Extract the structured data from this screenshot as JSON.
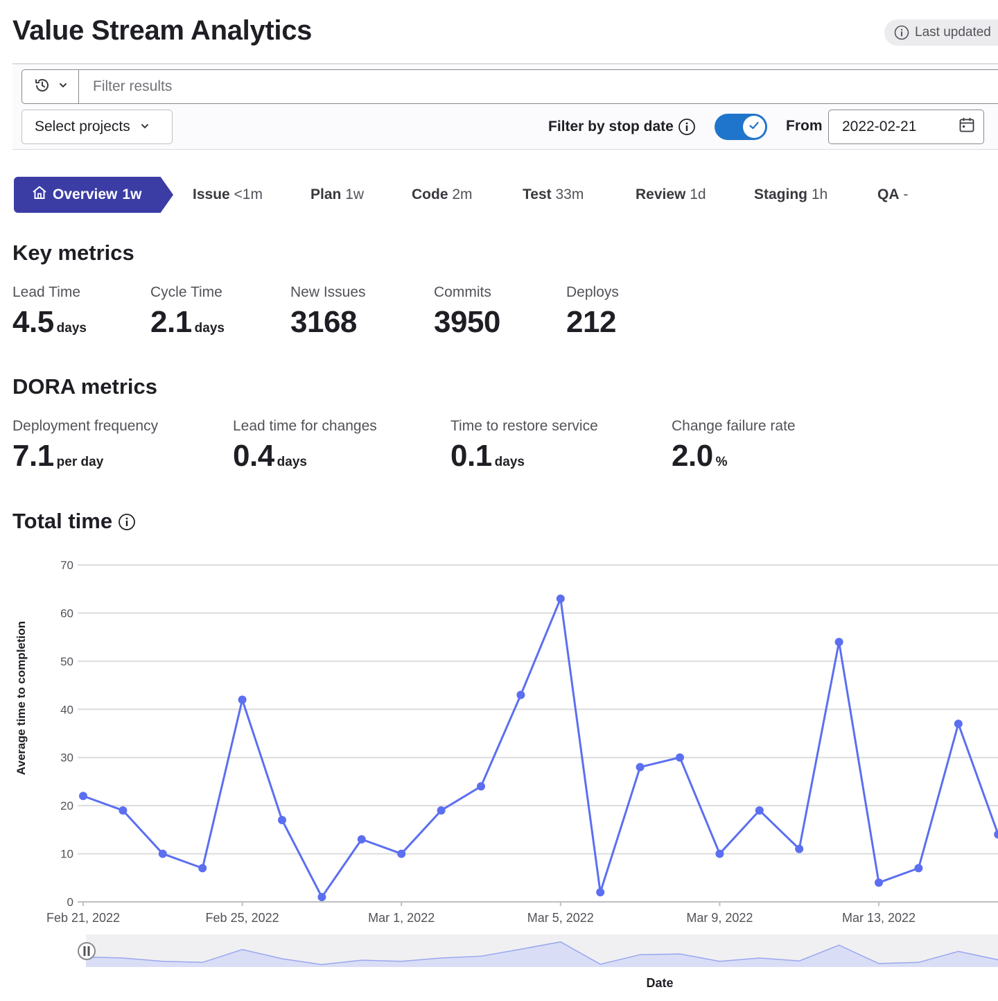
{
  "page": {
    "title": "Value Stream Analytics",
    "last_updated": "Last updated"
  },
  "filters": {
    "search_placeholder": "Filter results",
    "projects_label": "Select projects",
    "stop_date_label": "Filter by stop date",
    "stop_date_enabled": true,
    "from_label": "From",
    "from_date": "2022-02-21"
  },
  "stages": [
    {
      "name": "Overview",
      "time": "1w",
      "active": true
    },
    {
      "name": "Issue",
      "time": "<1m"
    },
    {
      "name": "Plan",
      "time": "1w"
    },
    {
      "name": "Code",
      "time": "2m"
    },
    {
      "name": "Test",
      "time": "33m"
    },
    {
      "name": "Review",
      "time": "1d"
    },
    {
      "name": "Staging",
      "time": "1h"
    },
    {
      "name": "QA",
      "time": "-"
    }
  ],
  "key_metrics": {
    "heading": "Key metrics",
    "items": [
      {
        "label": "Lead Time",
        "value": "4.5",
        "unit": "days"
      },
      {
        "label": "Cycle Time",
        "value": "2.1",
        "unit": "days"
      },
      {
        "label": "New Issues",
        "value": "3168",
        "unit": ""
      },
      {
        "label": "Commits",
        "value": "3950",
        "unit": ""
      },
      {
        "label": "Deploys",
        "value": "212",
        "unit": ""
      }
    ]
  },
  "dora_metrics": {
    "heading": "DORA metrics",
    "items": [
      {
        "label": "Deployment frequency",
        "value": "7.1",
        "unit": "per day"
      },
      {
        "label": "Lead time for changes",
        "value": "0.4",
        "unit": "days"
      },
      {
        "label": "Time to restore service",
        "value": "0.1",
        "unit": "days"
      },
      {
        "label": "Change failure rate",
        "value": "2.0",
        "unit": "%"
      }
    ]
  },
  "colors": {
    "accent": "#5b6ff0",
    "tab_active": "#3b3da5",
    "toggle": "#1f75cb"
  },
  "chart_data": {
    "type": "line",
    "title": "Total time",
    "xlabel": "Date",
    "ylabel": "Average time to completion",
    "ylim": [
      0,
      70
    ],
    "yticks": [
      0,
      10,
      20,
      30,
      40,
      50,
      60,
      70
    ],
    "xticks": [
      "Feb 21, 2022",
      "Feb 25, 2022",
      "Mar 1, 2022",
      "Mar 5, 2022",
      "Mar 9, 2022",
      "Mar 13, 2022"
    ],
    "grid": true,
    "x": [
      "2022-02-21",
      "2022-02-22",
      "2022-02-23",
      "2022-02-24",
      "2022-02-25",
      "2022-02-26",
      "2022-02-27",
      "2022-02-28",
      "2022-03-01",
      "2022-03-02",
      "2022-03-03",
      "2022-03-04",
      "2022-03-05",
      "2022-03-06",
      "2022-03-07",
      "2022-03-08",
      "2022-03-09",
      "2022-03-10",
      "2022-03-11",
      "2022-03-12",
      "2022-03-13",
      "2022-03-14",
      "2022-03-15",
      "2022-03-16"
    ],
    "series": [
      {
        "values": [
          22,
          19,
          10,
          7,
          42,
          17,
          1,
          13,
          10,
          19,
          24,
          43,
          63,
          2,
          28,
          30,
          10,
          19,
          11,
          54,
          4,
          7,
          37,
          14
        ]
      }
    ]
  }
}
